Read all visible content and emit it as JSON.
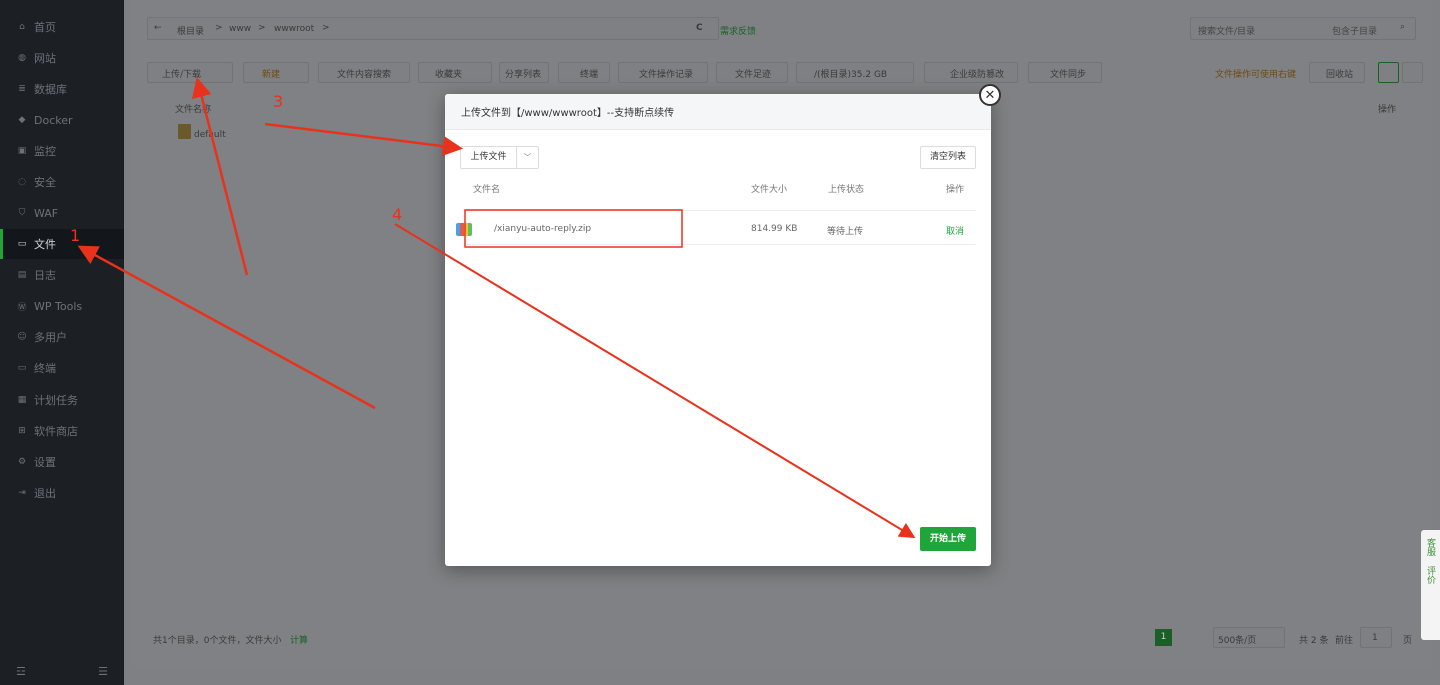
{
  "sidebar": {
    "items": [
      {
        "label": "首页",
        "icon": "home-icon"
      },
      {
        "label": "网站",
        "icon": "globe-icon"
      },
      {
        "label": "数据库",
        "icon": "database-icon"
      },
      {
        "label": "Docker",
        "icon": "docker-icon"
      },
      {
        "label": "监控",
        "icon": "monitor-icon"
      },
      {
        "label": "安全",
        "icon": "shield-icon"
      },
      {
        "label": "WAF",
        "icon": "waf-icon"
      },
      {
        "label": "文件",
        "icon": "folder-icon",
        "active": true
      },
      {
        "label": "日志",
        "icon": "log-icon"
      },
      {
        "label": "WP Tools",
        "icon": "wordpress-icon"
      },
      {
        "label": "多用户",
        "icon": "users-icon"
      },
      {
        "label": "终端",
        "icon": "terminal-icon"
      },
      {
        "label": "计划任务",
        "icon": "calendar-icon"
      },
      {
        "label": "软件商店",
        "icon": "apps-icon"
      },
      {
        "label": "设置",
        "icon": "gear-icon"
      },
      {
        "label": "退出",
        "icon": "logout-icon"
      }
    ],
    "bottom_left": "☲",
    "bottom_right": "☰"
  },
  "pathbar": {
    "back": "←",
    "crumbs": [
      "根目录",
      "www",
      "wwwroot"
    ],
    "sep": ">",
    "refresh": "C",
    "feedback": "需求反馈",
    "search_placeholder": "搜索文件/目录",
    "include_sub": "包含子目录"
  },
  "toolbar": {
    "upload_download": "上传/下载",
    "new": "新建",
    "content_search": "文件内容搜索",
    "favorites": "收藏夹",
    "share_list": "分享列表",
    "terminal": "终端",
    "op_records": "文件操作记录",
    "footprint": "文件足迹",
    "disk": "/(根目录)35.2 GB",
    "tamper": "企业级防篡改",
    "sync": "文件同步",
    "right_tip": "文件操作可使用右键",
    "recycle": "回收站"
  },
  "file_list": {
    "col_name": "文件名称",
    "col_ops": "操作",
    "rows": [
      {
        "name": "default"
      }
    ]
  },
  "footer": {
    "summary": "共1个目录，0个文件，文件大小",
    "calc": "计算",
    "page": "1",
    "per_page": "500条/页",
    "total": "共 2 条",
    "goto": "前往",
    "goto_val": "1",
    "page_suffix": "页"
  },
  "modal": {
    "title": "上传文件到【/www/wwwroot】--支持断点续传",
    "upload_file": "上传文件",
    "clear_list": "清空列表",
    "headers": {
      "name": "文件名",
      "size": "文件大小",
      "status": "上传状态",
      "ops": "操作"
    },
    "files": [
      {
        "name": "/xianyu-auto-reply.zip",
        "size": "814.99 KB",
        "status": "等待上传",
        "action": "取消"
      }
    ],
    "start_upload": "开始上传"
  },
  "annotations": [
    "1",
    "3",
    "4"
  ],
  "float_tabs": [
    "客服",
    "评价"
  ],
  "colors": {
    "accent": "#20a53a",
    "annotation": "#e8321c",
    "sidebar_bg": "#1c1f24"
  }
}
